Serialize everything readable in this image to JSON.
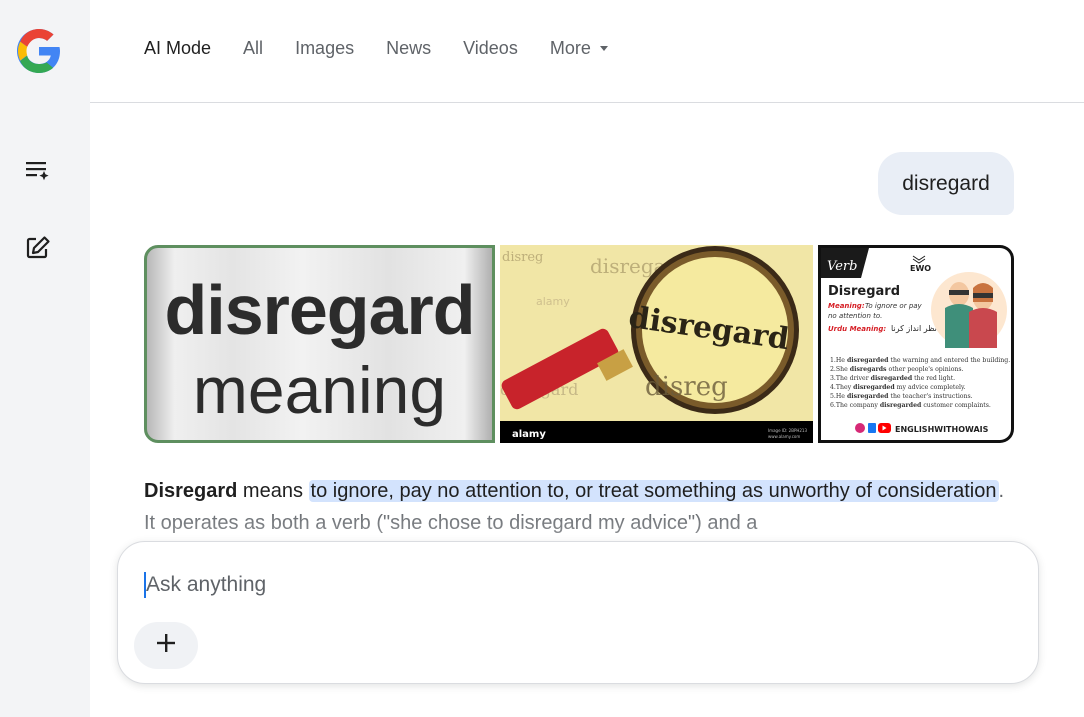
{
  "sidebar": {
    "logo_icon": "google-g-icon",
    "items": [
      {
        "icon": "history-icon"
      },
      {
        "icon": "new-chat-icon"
      }
    ]
  },
  "tabs": [
    {
      "label": "AI Mode",
      "active": true
    },
    {
      "label": "All"
    },
    {
      "label": "Images"
    },
    {
      "label": "News"
    },
    {
      "label": "Videos"
    },
    {
      "label": "More"
    }
  ],
  "query": "disregard",
  "images": [
    {
      "line1": "disregard",
      "line2": "meaning"
    },
    {
      "words": [
        "disreg",
        "disregard",
        "disreg",
        "disregard",
        "disregard"
      ],
      "watermark": "alamy",
      "footer_brand": "alamy",
      "footer_id": "Image ID: 2BPH213",
      "footer_site": "www.alamy.com"
    },
    {
      "script_label": "Verb",
      "brand": "EWO",
      "title": "Disregard",
      "meaning_label": "Meaning:",
      "meaning_text": "To ignore or pay no attention to.",
      "urdu_label": "Urdu Meaning:",
      "urdu_text": "نظر انداز کرنا",
      "examples": [
        {
          "pre": "1.He ",
          "b": "disregarded",
          "post": " the warning and entered the building."
        },
        {
          "pre": "2.She ",
          "b": "disregards",
          "post": " other people's opinions."
        },
        {
          "pre": "3.The driver ",
          "b": "disregarded",
          "post": " the red light."
        },
        {
          "pre": "4.They ",
          "b": "disregarded",
          "post": " my advice completely."
        },
        {
          "pre": "5.He ",
          "b": "disregarded",
          "post": " the teacher's instructions."
        },
        {
          "pre": "6.The company ",
          "b": "disregarded",
          "post": " customer complaints."
        }
      ],
      "footer_handle": "ENGLISHWITHOWAIS"
    }
  ],
  "answer": {
    "term": "Disregard",
    "means": " means ",
    "highlight": "to ignore, pay no attention to, or treat something as unworthy of consideration",
    "rest": ". It operates as both a verb (\"she chose to disregard my advice\") and a"
  },
  "input": {
    "placeholder": "Ask anything",
    "add_icon": "plus-icon"
  },
  "colors": {
    "accent": "#1a73e8",
    "highlight": "#d3e3fd",
    "bubble": "#e9eef6",
    "sidebar": "#f3f4f6"
  }
}
